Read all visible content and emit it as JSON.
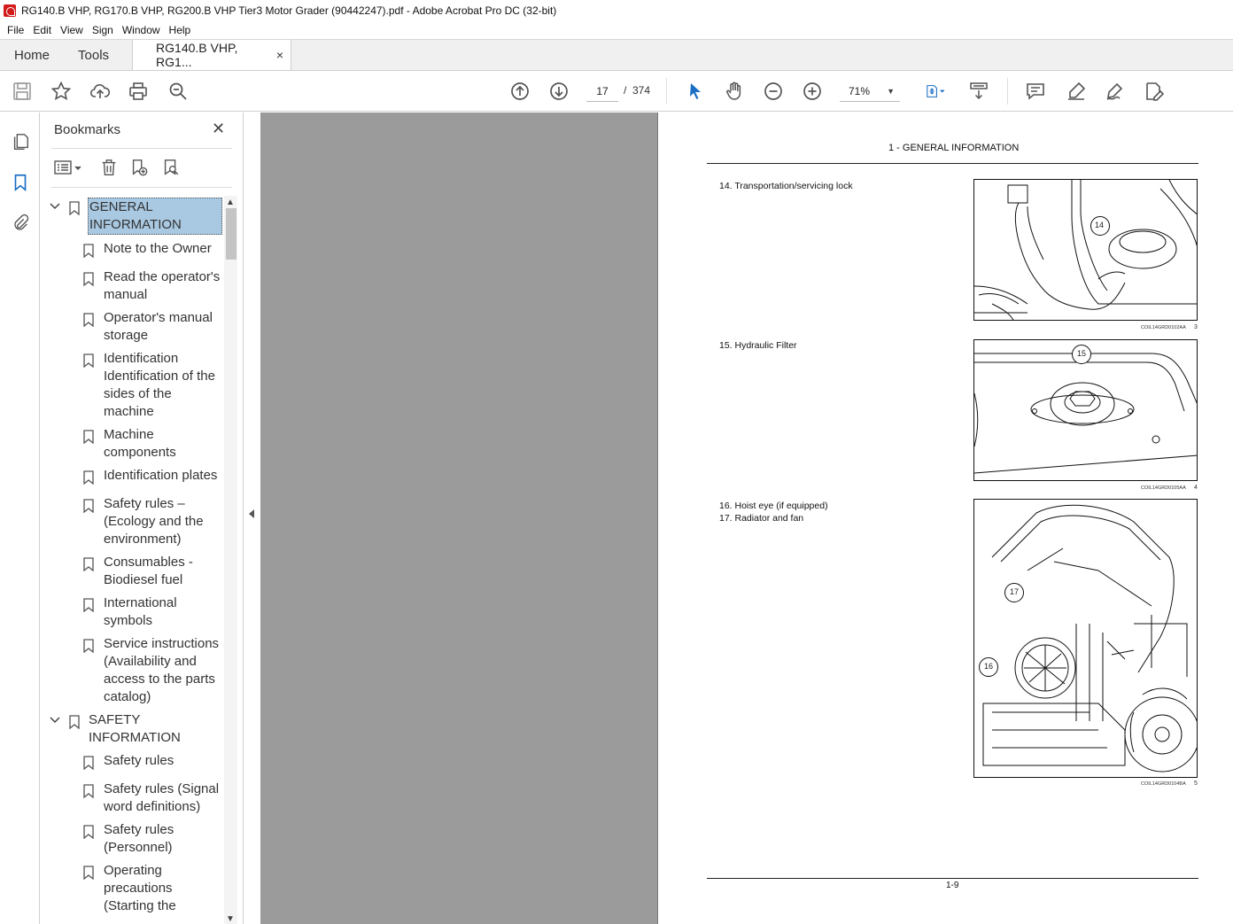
{
  "window": {
    "title": "RG140.B VHP, RG170.B VHP, RG200.B VHP Tier3 Motor Grader (90442247).pdf - Adobe Acrobat Pro DC (32-bit)"
  },
  "menu": [
    "File",
    "Edit",
    "View",
    "Sign",
    "Window",
    "Help"
  ],
  "tabs": {
    "home": "Home",
    "tools": "Tools",
    "document": "RG140.B VHP, RG1...",
    "close": "×"
  },
  "toolbar": {
    "current_page": "17",
    "page_separator": "/",
    "total_pages": "374",
    "zoom": "71%"
  },
  "bookmarks": {
    "title": "Bookmarks",
    "close": "✕",
    "items": [
      {
        "label": "GENERAL INFORMATION",
        "level": 0,
        "expanded": true,
        "selected": true
      },
      {
        "label": "Note to the Owner",
        "level": 1
      },
      {
        "label": "Read the operator's manual",
        "level": 1
      },
      {
        "label": "Operator's manual storage",
        "level": 1
      },
      {
        "label": "Identification Identification of the sides of the machine",
        "level": 1
      },
      {
        "label": "Machine components",
        "level": 1
      },
      {
        "label": "Identification plates",
        "level": 1
      },
      {
        "label": "Safety rules – (Ecology and the environment)",
        "level": 1
      },
      {
        "label": "Consumables - Biodiesel fuel",
        "level": 1
      },
      {
        "label": "International symbols",
        "level": 1
      },
      {
        "label": "Service instructions (Availability and access to the parts catalog)",
        "level": 1
      },
      {
        "label": "SAFETY INFORMATION",
        "level": 0,
        "expanded": true
      },
      {
        "label": "Safety rules",
        "level": 1
      },
      {
        "label": "Safety rules (Signal word definitions)",
        "level": 1
      },
      {
        "label": "Safety rules (Personnel)",
        "level": 1
      },
      {
        "label": "Operating precautions (Starting the",
        "level": 1
      }
    ]
  },
  "document": {
    "header": "1 - GENERAL INFORMATION",
    "footer": "1-9",
    "figures": [
      {
        "captions": [
          "14.  Transportation/servicing lock"
        ],
        "callouts": [
          "14"
        ],
        "code": "COIL14GRD0102AA",
        "number": "3"
      },
      {
        "captions": [
          "15.  Hydraulic Filter"
        ],
        "callouts": [
          "15"
        ],
        "code": "COIL14GRD0105AA",
        "number": "4"
      },
      {
        "captions": [
          "16.  Hoist eye (if equipped)",
          "17.  Radiator and fan"
        ],
        "callouts": [
          "17",
          "16"
        ],
        "code": "COIL14GRD0104BA",
        "number": "5"
      }
    ]
  },
  "colors": {
    "selection": "#a9c9e2",
    "doc_background": "#9b9b9b",
    "toolbar_blue": "#1a6fc4"
  }
}
